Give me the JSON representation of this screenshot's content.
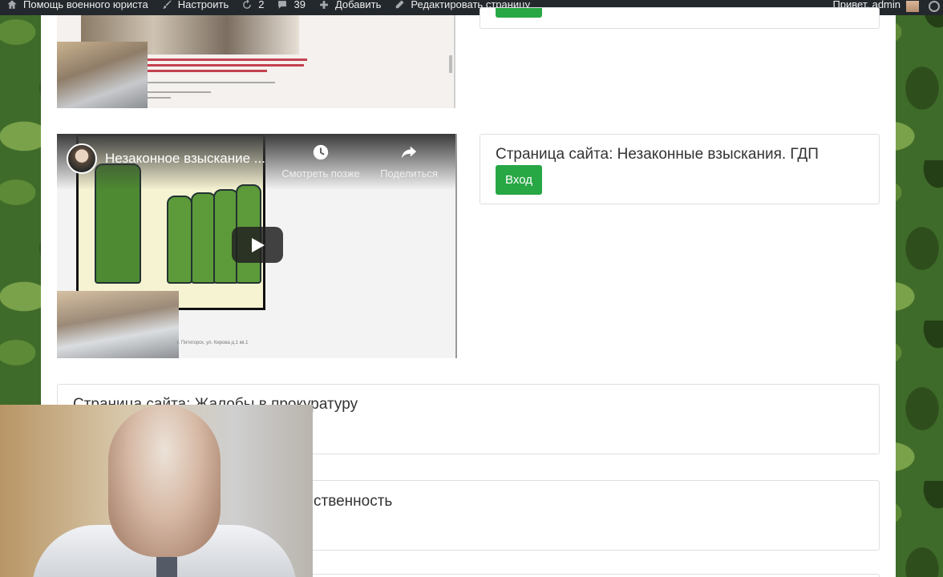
{
  "adminbar": {
    "site_name": "Помощь военного юриста",
    "customize": "Настроить",
    "updates_count": "2",
    "comments_count": "39",
    "new_label": "Добавить",
    "edit_page": "Редактировать страницу",
    "greeting": "Привет, admin"
  },
  "video": {
    "title": "Незаконное взыскание ...",
    "watch_later": "Смотреть позже",
    "share": "Поделиться"
  },
  "cards": [
    {
      "title": "Страница сайта: Незаконные взыскания. ГДП",
      "button": "Вход"
    },
    {
      "title": "Страница сайта: Жалобы в прокуратуру"
    },
    {
      "title_partial": "ственность"
    }
  ],
  "colors": {
    "adminbar_bg": "#23282d",
    "button_green": "#28a745",
    "camo_green": "#3f6b2a"
  }
}
